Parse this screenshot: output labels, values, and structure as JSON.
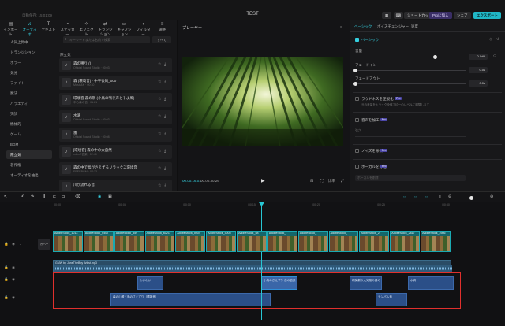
{
  "app": {
    "autosave_label": "自動保存: 15:01:09",
    "project_title": "TEST",
    "shortcut_label": "ショートカット",
    "pro_label": "Proに加入",
    "share_label": "シェア",
    "export_label": "エクスポート"
  },
  "media_tabs": [
    {
      "icon": "▤",
      "label": "インポート"
    },
    {
      "icon": "♫",
      "label": "オーディオ"
    },
    {
      "icon": "T",
      "label": "テキスト"
    },
    {
      "icon": "◔",
      "label": "ステッカー"
    },
    {
      "icon": "✧",
      "label": "エフェクト"
    },
    {
      "icon": "⇄",
      "label": "トランジション"
    },
    {
      "icon": "▭",
      "label": "キャプション"
    },
    {
      "icon": "◑",
      "label": "フィルター"
    },
    {
      "icon": "≡",
      "label": "調整"
    }
  ],
  "categories": [
    "人気上昇中",
    "トランジション",
    "ホラー",
    "気分",
    "ファイト",
    "魔法",
    "バラエティ",
    "笑顔",
    "機械的",
    "ゲーム",
    "BGM",
    "際立気",
    "著作権",
    "オーディオを抽出"
  ],
  "selected_category": "際立気",
  "search": {
    "placeholder": "キーワードまたは名前で検索",
    "filter_label": "すべて"
  },
  "section_title": "際立気",
  "tracks": [
    {
      "title": "森の鳴り ()",
      "sub": "Official Sound Studio · 00:03"
    },
    {
      "title": "森 (環境音) · 中午後的_000",
      "sub": "Music&K · 00:30"
    },
    {
      "title": "環境音 森の朝 (小鳥の鳴き声とそよ風)",
      "sub": "中心森の音 · 01:21"
    },
    {
      "title": "水滴",
      "sub": "Official Sound Studio · 00:03"
    },
    {
      "title": "雷",
      "sub": "Official Sound Studio · 00:08"
    },
    {
      "title": "[環境音] 森の中の大自然",
      "sub": "mLmE音楽 · 02:40"
    },
    {
      "title": "森の中で鳥がさえずるリラックス環境音",
      "sub": "FREEBGM · 04:13"
    },
    {
      "title": "川が流れる音",
      "sub": ""
    }
  ],
  "player": {
    "title": "プレーヤー",
    "timecode_current": "00:00:16:01",
    "timecode_duration": "00:00:30:26",
    "ratio_label": "比率"
  },
  "props": {
    "tabs": [
      "ベーシック",
      "ボイスチェンジャー",
      "速度"
    ],
    "section_basic": "ベーシック",
    "volume_label": "音量",
    "volume_value": "0.0dB",
    "fadein_label": "フェードイン",
    "fadein_value": "0.0s",
    "fadeout_label": "フェードアウト",
    "fadeout_value": "0.0s",
    "normalize_label": "ラウドネスを正規化",
    "normalize_desc": "元の音量をトラック全体で均一のレベルに調整します",
    "enhance_label": "音声を加工",
    "enhance_sub": "強さ",
    "noise_label": "ノイズを除去",
    "vocal_label": "ボーカルを分離",
    "vocal_select": "ボーカルを削除",
    "pro_badge": "Pro"
  },
  "timeline": {
    "ruler_ticks": [
      "00:00",
      "|00:05",
      "|00:10",
      "|00:15",
      "|00:20",
      "|00:25",
      "|00:30"
    ],
    "cover_label": "カバー",
    "video_clips": [
      "AdobeStock_1013",
      "AdobeStock_6402",
      "AdobeStock_559",
      "AdobeStock_6121",
      "AdobeStock_5004",
      "AdobeStock_5005",
      "AdobeStock_58",
      "AdobeStock_",
      "AdobeStock_",
      "AdobeStock_",
      "AdobeStock_2",
      "AdobeStock_2817",
      "AdobeStock_2566"
    ],
    "audio_bgm": "GMW by JaneTheBoy Artlist.mp3",
    "audio_clips": [
      {
        "label": "わいわい"
      },
      {
        "label": "小鳥のさえずり 自の音楽"
      },
      {
        "label": "朝演劇の大気隠の重の"
      },
      {
        "label": "水滴"
      }
    ],
    "audio_clips_row2": [
      {
        "label": "森の山麓と鳥のさえずり（環境音）"
      },
      {
        "label": "テンパル音"
      }
    ]
  },
  "colors": {
    "accent": "#35d0e0",
    "highlight_box": "#e0302d",
    "export_button": "#20b7c6"
  }
}
